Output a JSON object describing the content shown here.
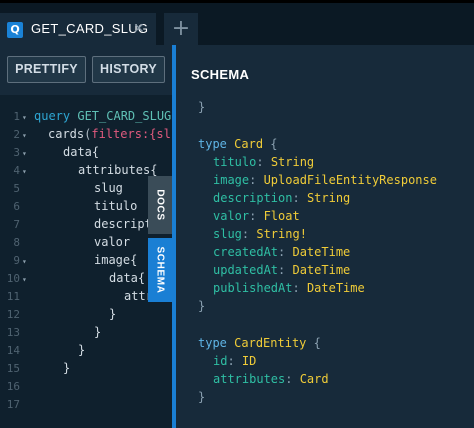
{
  "tab": {
    "icon": "Q",
    "title": "GET_CARD_SLUG",
    "close": "✕",
    "add": "+"
  },
  "toolbar": {
    "prettify_label": "PRETTIFY",
    "history_label": "HISTORY"
  },
  "editor": {
    "line_numbers": [
      "1",
      "2",
      "3",
      "4",
      "5",
      "6",
      "7",
      "8",
      "9",
      "10",
      "11",
      "12",
      "13",
      "14",
      "15",
      "16",
      "17"
    ],
    "fold_markers": [
      "▾",
      "▾",
      "▾",
      "▾",
      "",
      "",
      "",
      "",
      "▾",
      "▾",
      "",
      "",
      "",
      "",
      "",
      "",
      ""
    ],
    "query_keyword": "query",
    "query_name": "GET_CARD_SLUG",
    "line2_field": "cards",
    "line2_arg": "filters",
    "line2_rest": ":{sl",
    "line3": "data{",
    "line4": "attributes{",
    "line5": "slug",
    "line6": "titulo",
    "line7": "descriptio",
    "line8": "valor",
    "line9": "image{",
    "line10": "data{",
    "line11": "attr",
    "line12": "}",
    "line13": "}",
    "line14": "}",
    "line15": "}"
  },
  "side_tabs": {
    "docs": "DOCS",
    "schema": "SCHEMA"
  },
  "schema": {
    "title": "SCHEMA",
    "close_brace": "}",
    "card_type": {
      "keyword": "type",
      "name": "Card",
      "fields": [
        {
          "name": "titulo",
          "type": "String"
        },
        {
          "name": "image",
          "type": "UploadFileEntityResponse"
        },
        {
          "name": "description",
          "type": "String"
        },
        {
          "name": "valor",
          "type": "Float"
        },
        {
          "name": "slug",
          "type": "String!"
        },
        {
          "name": "createdAt",
          "type": "DateTime"
        },
        {
          "name": "updatedAt",
          "type": "DateTime"
        },
        {
          "name": "publishedAt",
          "type": "DateTime"
        }
      ]
    },
    "card_entity_type": {
      "keyword": "type",
      "name": "CardEntity",
      "fields": [
        {
          "name": "id",
          "type": "ID"
        },
        {
          "name": "attributes",
          "type": "Card"
        }
      ]
    }
  }
}
